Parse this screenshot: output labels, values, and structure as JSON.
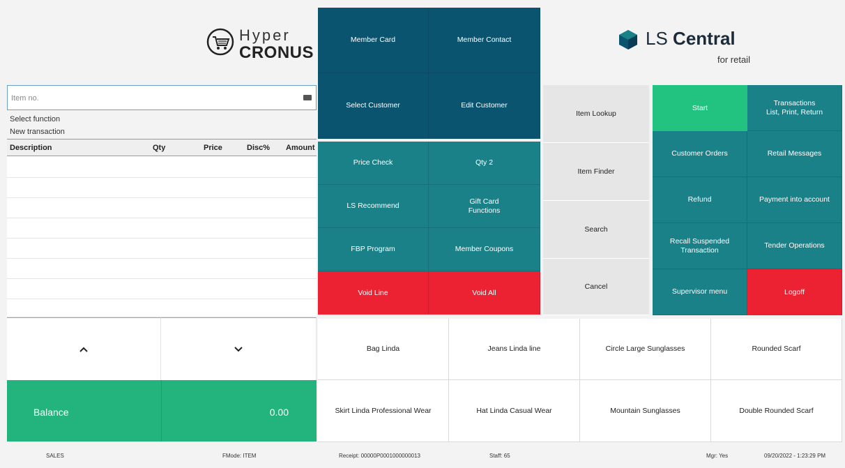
{
  "logo": {
    "hyper": "Hyper",
    "cronus": "CRONUS"
  },
  "brand": {
    "ls": "LS",
    "central": "Central",
    "sub": "for retail"
  },
  "input": {
    "placeholder": "Item no.",
    "value": ""
  },
  "info": {
    "line1": "Select function",
    "line2": "New transaction"
  },
  "table": {
    "columns": [
      "Description",
      "Qty",
      "Price",
      "Disc%",
      "Amount"
    ],
    "rows": []
  },
  "balance": {
    "label": "Balance",
    "value": "0.00"
  },
  "buttons": {
    "member_card": "Member Card",
    "member_contact": "Member Contact",
    "select_customer": "Select Customer",
    "edit_customer": "Edit Customer",
    "price_check": "Price Check",
    "qty2": "Qty 2",
    "ls_recommend": "LS Recommend",
    "gift_card_1": "Gift Card",
    "gift_card_2": "Functions",
    "fbp_program": "FBP Program",
    "member_coupons": "Member Coupons",
    "void_line": "Void Line",
    "void_all": "Void All",
    "item_lookup": "Item Lookup",
    "item_finder": "Item Finder",
    "search": "Search",
    "cancel": "Cancel",
    "start": "Start",
    "transactions_1": "Transactions",
    "transactions_2": "List, Print, Return",
    "customer_orders": "Customer Orders",
    "retail_messages": "Retail Messages",
    "refund": "Refund",
    "payment_into_account": "Payment into account",
    "recall_1": "Recall Suspended",
    "recall_2": "Transaction",
    "tender_operations": "Tender Operations",
    "supervisor_menu": "Supervisor menu",
    "logoff": "Logoff"
  },
  "items": [
    "Bag Linda",
    "Jeans Linda line",
    "Circle Large Sunglasses",
    "Rounded Scarf",
    "Skirt Linda Professional Wear",
    "Hat Linda Casual Wear",
    "Mountain Sunglasses",
    "Double Rounded Scarf"
  ],
  "status": {
    "mode": "SALES",
    "fmode": "FMode: ITEM",
    "receipt": "Receipt: 00000P0001000000013",
    "staff": "Staff: 65",
    "mgr": "Mgr: Yes",
    "datetime": "09/20/2022 - 1:23:29 PM"
  },
  "colors": {
    "navy": "#0b5470",
    "teal": "#1b8189",
    "red": "#ec2232",
    "green": "#22c281",
    "balance_green": "#22b47c",
    "grey": "#e6e6e6"
  },
  "icons": [
    "shopping-cart-icon",
    "keyboard-icon",
    "chevron-up-icon",
    "chevron-down-icon",
    "ls-central-logo-icon"
  ]
}
